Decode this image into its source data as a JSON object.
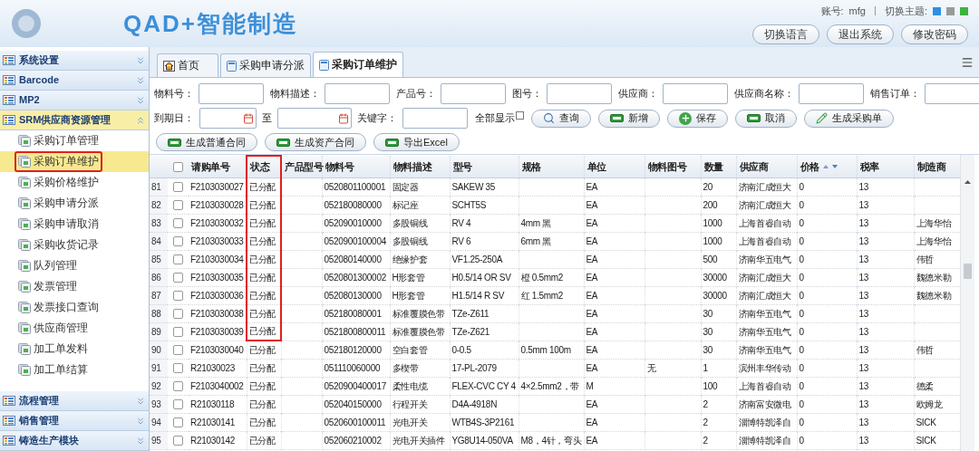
{
  "header": {
    "title": "QAD+智能制造",
    "account_label": "账号:",
    "account": "mfg",
    "theme_label": "切换主题:",
    "themes": [
      {
        "color": "#2f8fe0"
      },
      {
        "color": "#9a9a9a"
      },
      {
        "color": "#3cb43c"
      }
    ],
    "buttons": [
      "切换语言",
      "退出系统",
      "修改密码"
    ]
  },
  "sidebar": {
    "sections": [
      {
        "label": "系统设置",
        "expanded": false
      },
      {
        "label": "Barcode",
        "expanded": false
      },
      {
        "label": "MP2",
        "expanded": false
      },
      {
        "label": "SRM供应商资源管理",
        "expanded": true,
        "items": [
          {
            "label": "采购订单管理",
            "selected": false,
            "annotated": false
          },
          {
            "label": "采购订单维护",
            "selected": true,
            "annotated": true
          },
          {
            "label": "采购价格维护",
            "selected": false,
            "annotated": false
          },
          {
            "label": "采购申请分派",
            "selected": false,
            "annotated": false
          },
          {
            "label": "采购申请取消",
            "selected": false,
            "annotated": false
          },
          {
            "label": "采购收货记录",
            "selected": false,
            "annotated": false
          },
          {
            "label": "队列管理",
            "selected": false,
            "annotated": false
          },
          {
            "label": "发票管理",
            "selected": false,
            "annotated": false
          },
          {
            "label": "发票接口查询",
            "selected": false,
            "annotated": false
          },
          {
            "label": "供应商管理",
            "selected": false,
            "annotated": false
          },
          {
            "label": "加工单发料",
            "selected": false,
            "annotated": false
          },
          {
            "label": "加工单结算",
            "selected": false,
            "annotated": false
          }
        ]
      },
      {
        "label": "流程管理",
        "expanded": false
      },
      {
        "label": "销售管理",
        "expanded": false
      },
      {
        "label": "铸造生产模块",
        "expanded": false
      }
    ]
  },
  "tabs": [
    {
      "label": "首页",
      "kind": "home",
      "selected": false
    },
    {
      "label": "采购申请分派",
      "kind": "page",
      "selected": false
    },
    {
      "label": "采购订单维护",
      "kind": "page",
      "selected": true
    }
  ],
  "filters": [
    {
      "label": "物料号：",
      "kind": "text"
    },
    {
      "label": "物料描述：",
      "kind": "text"
    },
    {
      "label": "产品号：",
      "kind": "text"
    },
    {
      "label": "图号：",
      "kind": "text"
    },
    {
      "label": "供应商：",
      "kind": "text"
    },
    {
      "label": "供应商名称：",
      "kind": "text"
    },
    {
      "label": "销售订单：",
      "kind": "text"
    },
    {
      "label": "到期日：",
      "kind": "date"
    },
    {
      "label": "至",
      "kind": "date"
    },
    {
      "label": "关键字：",
      "kind": "text"
    },
    {
      "label": "全部显示",
      "kind": "checkbox",
      "checked": false
    }
  ],
  "actions": [
    {
      "label": "查询",
      "kind": "search"
    },
    {
      "label": "新增",
      "kind": "bar"
    },
    {
      "label": "保存",
      "kind": "plus"
    },
    {
      "label": "取消",
      "kind": "bar"
    },
    {
      "label": "生成采购单",
      "kind": "pencil"
    },
    {
      "label": "生成普通合同",
      "kind": "bar"
    },
    {
      "label": "生成资产合同",
      "kind": "bar"
    },
    {
      "label": "导出Excel",
      "kind": "bar"
    }
  ],
  "table": {
    "all_checked": false,
    "columns": [
      {
        "label": "请购单号",
        "annotated": false,
        "sortable": false
      },
      {
        "label": "状态",
        "annotated": true,
        "sortable": false
      },
      {
        "label": "产品型号",
        "annotated": false,
        "sortable": false
      },
      {
        "label": "物料号",
        "annotated": false,
        "sortable": false
      },
      {
        "label": "物料描述",
        "annotated": false,
        "sortable": false
      },
      {
        "label": "型号",
        "annotated": false,
        "sortable": false
      },
      {
        "label": "规格",
        "annotated": false,
        "sortable": false
      },
      {
        "label": "单位",
        "annotated": false,
        "sortable": false
      },
      {
        "label": "物料图号",
        "annotated": false,
        "sortable": false
      },
      {
        "label": "数量",
        "annotated": false,
        "sortable": false
      },
      {
        "label": "供应商",
        "annotated": false,
        "sortable": false
      },
      {
        "label": "价格",
        "annotated": false,
        "sortable": true
      },
      {
        "label": "税率",
        "annotated": false,
        "sortable": false
      },
      {
        "label": "制造商",
        "annotated": false,
        "sortable": false
      }
    ],
    "rows": [
      {
        "index": "81",
        "checked": false,
        "annotated": true,
        "cells": [
          "F2103030027",
          "已分配",
          "",
          "0520801100001",
          "固定器",
          "SAKEW 35",
          "",
          "EA",
          "",
          "20",
          "济南汇成恒大",
          "0",
          "13",
          ""
        ]
      },
      {
        "index": "82",
        "checked": false,
        "annotated": true,
        "cells": [
          "F2103030028",
          "已分配",
          "",
          "052180080000",
          "标记座",
          "SCHT5S",
          "",
          "EA",
          "",
          "200",
          "济南汇成恒大",
          "0",
          "13",
          ""
        ]
      },
      {
        "index": "83",
        "checked": false,
        "annotated": true,
        "cells": [
          "F2103030032",
          "已分配",
          "",
          "052090010000",
          "多股铜线",
          "RV 4",
          "4mm 黑",
          "EA",
          "",
          "1000",
          "上海首睿自动",
          "0",
          "13",
          "上海华怡"
        ]
      },
      {
        "index": "84",
        "checked": false,
        "annotated": true,
        "cells": [
          "F2103030033",
          "已分配",
          "",
          "0520900100004",
          "多股铜线",
          "RV 6",
          "6mm 黑",
          "EA",
          "",
          "1000",
          "上海首睿自动",
          "0",
          "13",
          "上海华怡"
        ]
      },
      {
        "index": "85",
        "checked": false,
        "annotated": true,
        "cells": [
          "F2103030034",
          "已分配",
          "",
          "052080140000",
          "绝缘护套",
          "VF1.25-250A",
          "",
          "EA",
          "",
          "500",
          "济南华五电气",
          "0",
          "13",
          "伟哲"
        ]
      },
      {
        "index": "86",
        "checked": false,
        "annotated": true,
        "cells": [
          "F2103030035",
          "已分配",
          "",
          "0520801300002",
          "H形套管",
          "H0.5/14 OR SV",
          "橙 0.5mm2",
          "EA",
          "",
          "30000",
          "济南汇成恒大",
          "0",
          "13",
          "魏德米勒"
        ]
      },
      {
        "index": "87",
        "checked": false,
        "annotated": true,
        "cells": [
          "F2103030036",
          "已分配",
          "",
          "052080130000",
          "H形套管",
          "H1.5/14 R SV",
          "红 1.5mm2",
          "EA",
          "",
          "30000",
          "济南汇成恒大",
          "0",
          "13",
          "魏德米勒"
        ]
      },
      {
        "index": "88",
        "checked": false,
        "annotated": true,
        "cells": [
          "F2103030038",
          "已分配",
          "",
          "052180080001",
          "标准覆膜色带",
          "TZe-Z611",
          "",
          "EA",
          "",
          "30",
          "济南华五电气",
          "0",
          "13",
          ""
        ]
      },
      {
        "index": "89",
        "checked": false,
        "annotated": true,
        "cells": [
          "F2103030039",
          "已分配",
          "",
          "0521800800011",
          "标准覆膜色带",
          "TZe-Z621",
          "",
          "EA",
          "",
          "30",
          "济南华五电气",
          "0",
          "13",
          ""
        ]
      },
      {
        "index": "90",
        "checked": false,
        "annotated": false,
        "cells": [
          "F2103030040",
          "已分配",
          "",
          "052180120000",
          "空白套管",
          "0-0.5",
          "0.5mm 100m",
          "EA",
          "",
          "30",
          "济南华五电气",
          "0",
          "13",
          "伟哲"
        ]
      },
      {
        "index": "91",
        "checked": false,
        "annotated": false,
        "cells": [
          "R21030023",
          "已分配",
          "",
          "051110060000",
          "多楔带",
          "17-PL-2079",
          "",
          "EA",
          "无",
          "1",
          "滨州丰华传动",
          "0",
          "13",
          ""
        ]
      },
      {
        "index": "92",
        "checked": false,
        "annotated": false,
        "cells": [
          "F2103040002",
          "已分配",
          "",
          "0520900400017",
          "柔性电缆",
          "FLEX-CVC CY 4",
          "4×2.5mm2，带",
          "M",
          "",
          "100",
          "上海首睿自动",
          "0",
          "13",
          "德柔"
        ]
      },
      {
        "index": "93",
        "checked": false,
        "annotated": false,
        "cells": [
          "R21030118",
          "已分配",
          "",
          "052040150000",
          "行程开关",
          "D4A-4918N",
          "",
          "EA",
          "",
          "2",
          "济南富安微电",
          "0",
          "13",
          "欧姆龙"
        ]
      },
      {
        "index": "94",
        "checked": false,
        "annotated": false,
        "cells": [
          "R21030141",
          "已分配",
          "",
          "0520600100011",
          "光电开关",
          "WTB4S-3P2161",
          "",
          "EA",
          "",
          "2",
          "淄博特凯泽自",
          "0",
          "13",
          "SICK"
        ]
      },
      {
        "index": "95",
        "checked": false,
        "annotated": false,
        "cells": [
          "R21030142",
          "已分配",
          "",
          "052060210002",
          "光电开关插件",
          "YG8U14-050VA",
          "M8，4针，弯头",
          "EA",
          "",
          "2",
          "淄博特凯泽自",
          "0",
          "13",
          "SICK"
        ]
      }
    ]
  }
}
